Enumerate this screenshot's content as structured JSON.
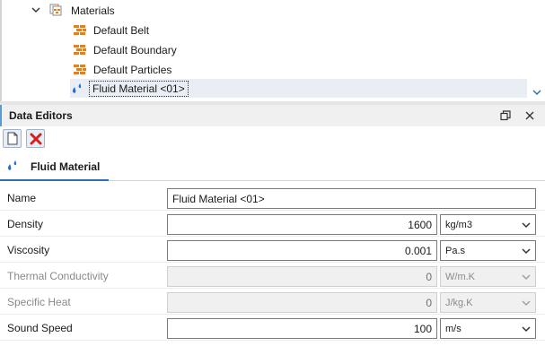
{
  "tree": {
    "root": {
      "label": "Materials"
    },
    "items": [
      {
        "label": "Default Belt"
      },
      {
        "label": "Default Boundary"
      },
      {
        "label": "Default Particles"
      },
      {
        "label": "Fluid Material <01>"
      }
    ]
  },
  "panel": {
    "title": "Data Editors"
  },
  "tab": {
    "label": "Fluid Material"
  },
  "form": {
    "name_label": "Name",
    "name_value": "Fluid Material <01>",
    "rows": [
      {
        "label": "Density",
        "value": "1600",
        "unit": "kg/m3",
        "enabled": true
      },
      {
        "label": "Viscosity",
        "value": "0.001",
        "unit": "Pa.s",
        "enabled": true
      },
      {
        "label": "Thermal Conductivity",
        "value": "0",
        "unit": "W/m.K",
        "enabled": false
      },
      {
        "label": "Specific Heat",
        "value": "0",
        "unit": "J/kg.K",
        "enabled": false
      },
      {
        "label": "Sound Speed",
        "value": "100",
        "unit": "m/s",
        "enabled": true
      }
    ]
  },
  "colors": {
    "accent": "#2f6fb3",
    "brick": "#d9822b",
    "drop": "#1f6fd1",
    "delete": "#d32020"
  }
}
